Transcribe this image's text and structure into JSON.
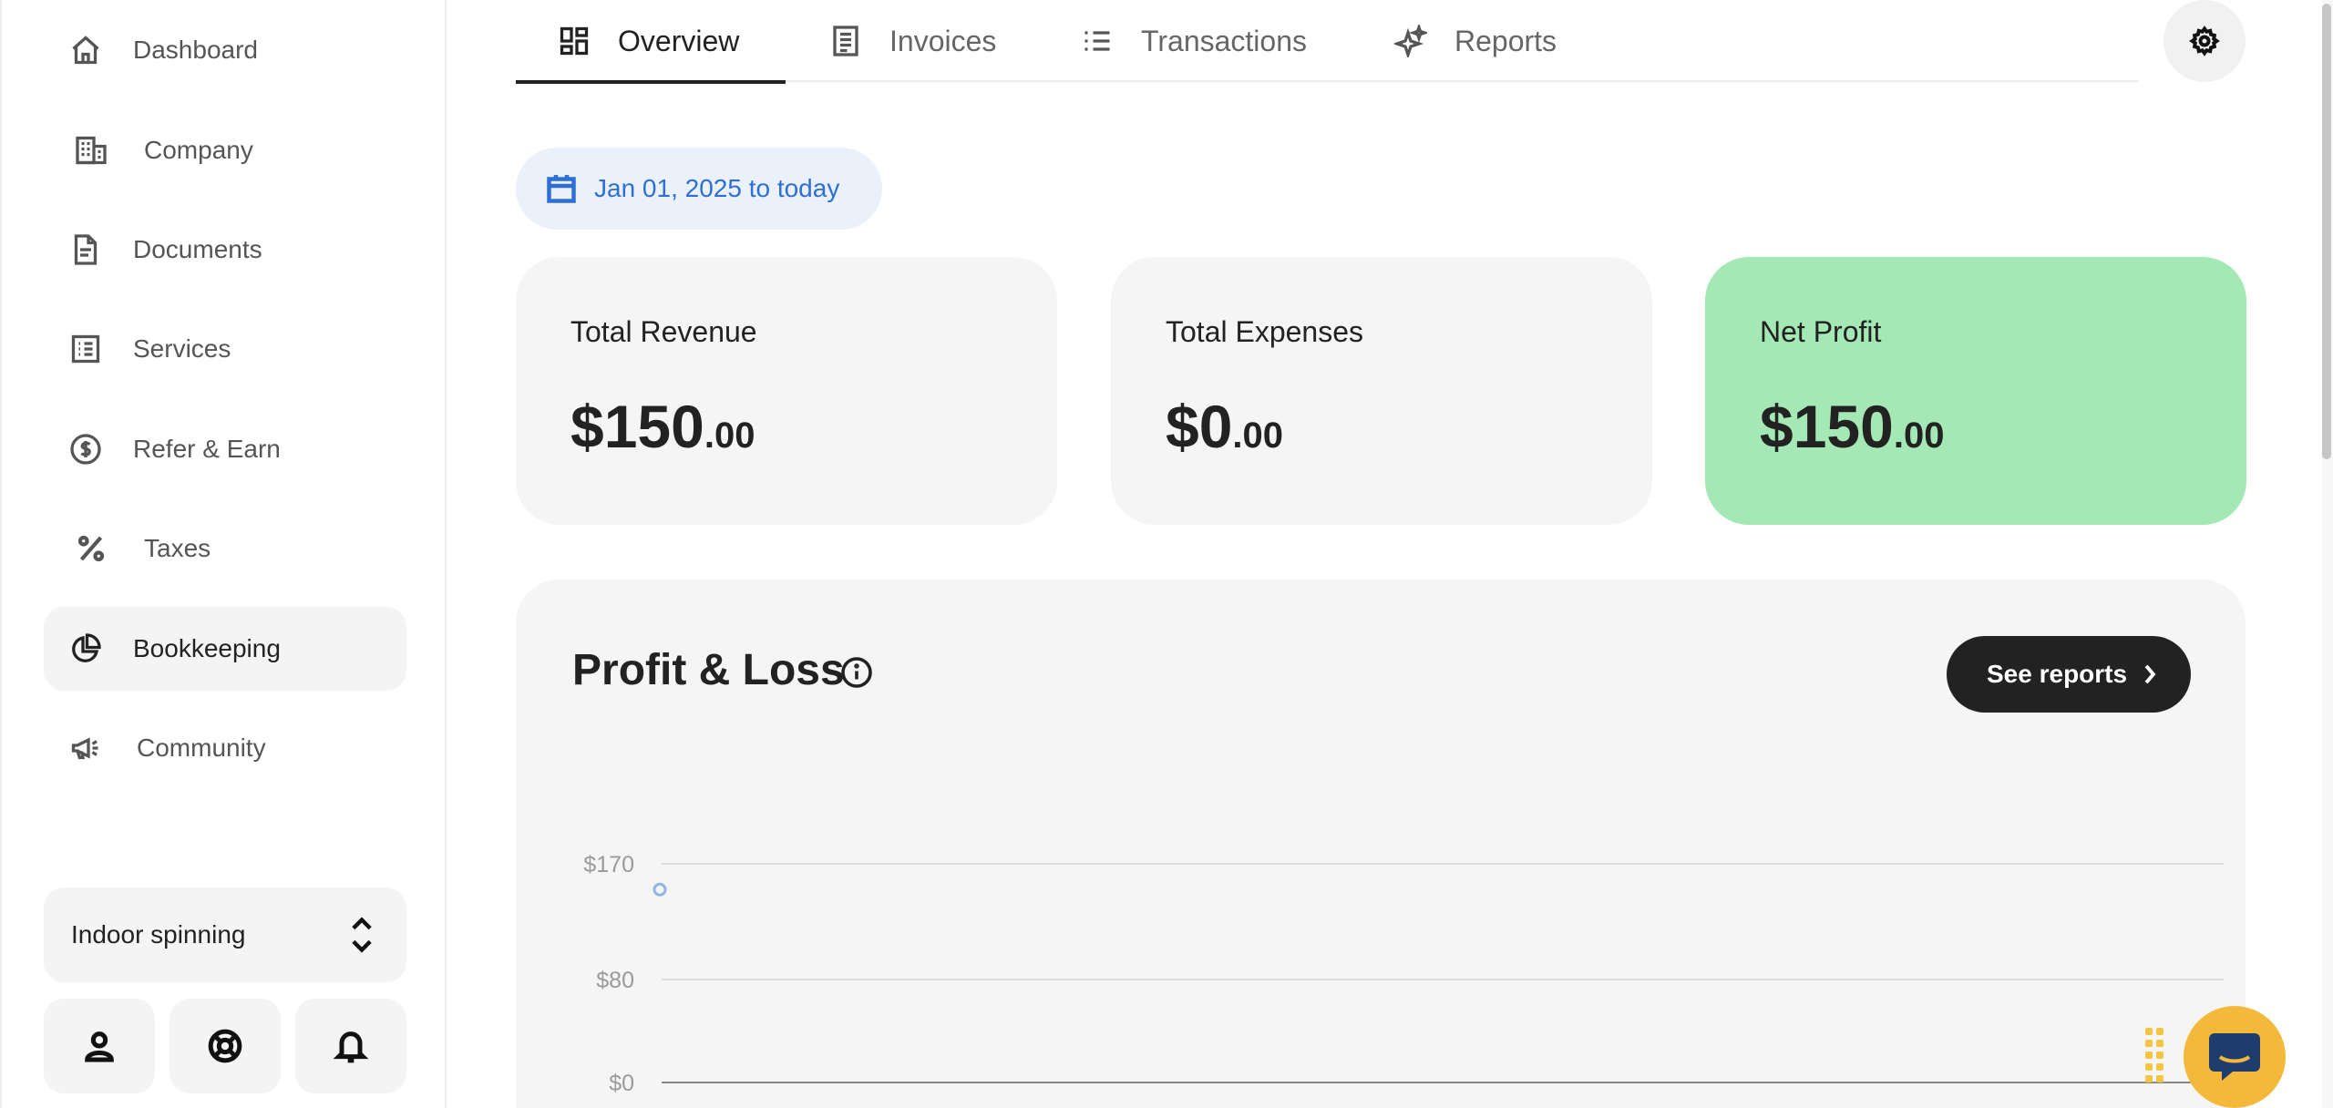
{
  "sidebar": {
    "items": [
      {
        "label": "Dashboard",
        "icon": "home-icon"
      },
      {
        "label": "Company",
        "icon": "building-icon"
      },
      {
        "label": "Documents",
        "icon": "document-icon"
      },
      {
        "label": "Services",
        "icon": "list-box-icon"
      },
      {
        "label": "Refer & Earn",
        "icon": "dollar-circle-icon"
      },
      {
        "label": "Taxes",
        "icon": "percent-icon"
      },
      {
        "label": "Bookkeeping",
        "icon": "pie-chart-icon",
        "active": true
      },
      {
        "label": "Community",
        "icon": "megaphone-icon"
      }
    ],
    "business_selector": "Indoor spinning",
    "bottom_buttons": [
      "user-icon",
      "lifebuoy-icon",
      "bell-icon"
    ]
  },
  "tabs": [
    {
      "label": "Overview",
      "icon": "grid-icon",
      "active": true
    },
    {
      "label": "Invoices",
      "icon": "invoice-icon"
    },
    {
      "label": "Transactions",
      "icon": "list-icon"
    },
    {
      "label": "Reports",
      "icon": "sparkle-icon"
    }
  ],
  "date_range": "Jan 01, 2025 to today",
  "cards": [
    {
      "label": "Total Revenue",
      "whole": "$150",
      "cents": ".00"
    },
    {
      "label": "Total Expenses",
      "whole": "$0",
      "cents": ".00"
    },
    {
      "label": "Net Profit",
      "whole": "$150",
      "cents": ".00",
      "highlight": "#a4e9b5"
    }
  ],
  "profit_loss": {
    "title": "Profit & Loss",
    "see_reports": "See reports"
  },
  "chart_data": {
    "type": "line",
    "title": "",
    "y_ticks": [
      "$170",
      "$80",
      "$0"
    ],
    "ylim": [
      0,
      170
    ],
    "series": [
      {
        "values": [
          150
        ]
      }
    ],
    "point_color": "#8fb6e8"
  },
  "colors": {
    "accent_blue": "#2f6fd4",
    "profit_green": "#a4e9b5",
    "chat_yellow": "#f4b93a"
  }
}
